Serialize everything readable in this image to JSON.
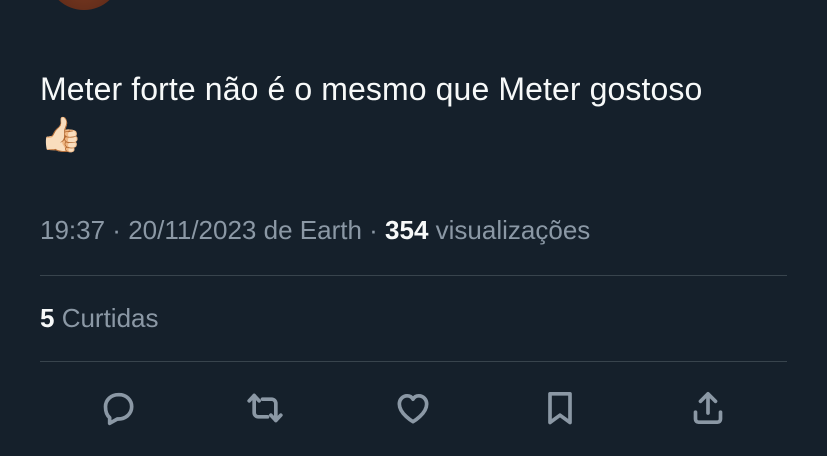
{
  "tweet": {
    "text": "Meter forte não é o mesmo que Meter gostoso",
    "emoji": "👍🏻"
  },
  "meta": {
    "time": "19:37",
    "separator1": " · ",
    "date": "20/11/2023",
    "source_prefix": " de ",
    "source": "Earth",
    "separator2": " · ",
    "views_count": "354",
    "views_label": " visualizações"
  },
  "likes": {
    "count": "5",
    "label": " Curtidas"
  },
  "actions": [
    {
      "name": "reply",
      "icon": "comment-icon"
    },
    {
      "name": "retweet",
      "icon": "retweet-icon"
    },
    {
      "name": "like",
      "icon": "heart-icon"
    },
    {
      "name": "bookmark",
      "icon": "bookmark-icon"
    },
    {
      "name": "share",
      "icon": "share-icon"
    }
  ],
  "colors": {
    "background": "#15202b",
    "text_primary": "#f7f9f9",
    "text_secondary": "#8b98a5",
    "divider": "#38444d"
  }
}
